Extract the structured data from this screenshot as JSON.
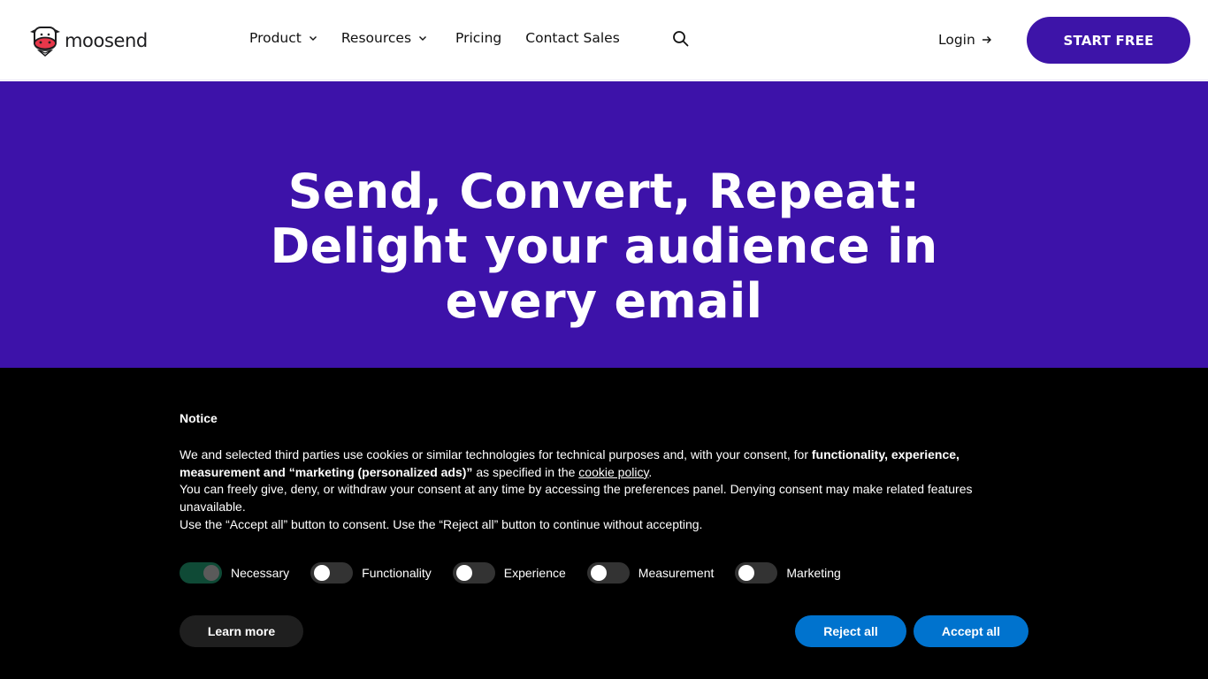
{
  "header": {
    "logo_text": "moosend",
    "nav": {
      "product": "Product",
      "resources": "Resources",
      "pricing": "Pricing",
      "contact": "Contact Sales"
    },
    "login": "Login",
    "start_free": "START FREE"
  },
  "hero": {
    "title": "Send, Convert, Repeat: Delight your audience in every email"
  },
  "cookie": {
    "title": "Notice",
    "p1_start": "We and selected third parties use cookies or similar technologies for technical purposes and, with your consent, for ",
    "p1_bold": "functionality, experience, measurement and “marketing (personalized ads)”",
    "p1_mid": " as specified in the ",
    "p1_link": "cookie policy",
    "p1_end": ".",
    "p2": "You can freely give, deny, or withdraw your consent at any time by accessing the preferences panel. Denying consent may make related features unavailable.",
    "p3": "Use the “Accept all” button to consent. Use the “Reject all” button to continue without accepting.",
    "toggles": [
      {
        "label": "Necessary",
        "on": true
      },
      {
        "label": "Functionality",
        "on": false
      },
      {
        "label": "Experience",
        "on": false
      },
      {
        "label": "Measurement",
        "on": false
      },
      {
        "label": "Marketing",
        "on": false
      }
    ],
    "learn_more": "Learn more",
    "reject_all": "Reject all",
    "accept_all": "Accept all"
  },
  "colors": {
    "brand_purple": "#3d12a9",
    "cookie_bg": "#000000",
    "accept_blue": "#0073ce",
    "toggle_on": "#0f4a36"
  },
  "icons": {
    "logo": "cow-logo-icon",
    "search": "search-icon",
    "chevron": "chevron-down-icon",
    "arrow": "arrow-right-icon"
  }
}
